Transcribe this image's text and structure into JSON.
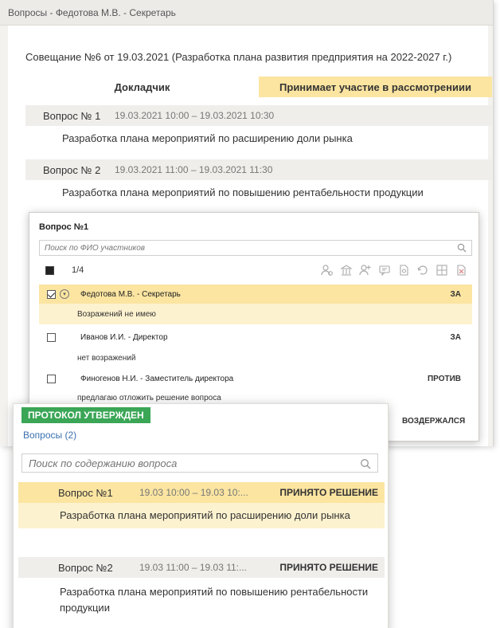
{
  "window1": {
    "title": "Вопросы - Федотова М.В. - Секретарь",
    "meeting": "Совещание №6 от 19.03.2021 (Разработка плана развития предприятия на 2022-2027 г.)",
    "tabs": [
      {
        "label": "Докладчик"
      },
      {
        "label": "Принимает участие в рассмотрениии"
      }
    ],
    "questions": [
      {
        "num": "Вопрос № 1",
        "time": "19.03.2021 10:00 – 19.03.2021 10:30",
        "text": "Разработка плана мероприятий по расширению доли рынка"
      },
      {
        "num": "Вопрос № 2",
        "time": "19.03.2021 11:00 – 19.03.2021 11:30",
        "text": "Разработка плана мероприятий по повышению рентабельности продукции"
      }
    ]
  },
  "window2": {
    "title": "Вопрос №1",
    "search_placeholder": "Поиск по ФИО участников",
    "counter": "1/4",
    "participants": [
      {
        "name": "Федотова М.В. - Секретарь",
        "vote": "ЗА",
        "comment": "Возражений не имею"
      },
      {
        "name": "Иванов И.И. - Директор",
        "vote": "ЗА",
        "comment": "нет возражений"
      },
      {
        "name": "Финогенов Н.И. - Заместитель директора",
        "vote": "ПРОТИВ",
        "comment": "предлагаю отложить решение вопроса"
      }
    ],
    "abstain": "ВОЗДЕРЖАЛСЯ"
  },
  "window3": {
    "badge": "ПРОТОКОЛ УТВЕРЖДЕН",
    "questions_link": "Вопросы (2)",
    "search_placeholder": "Поиск по содержанию вопроса",
    "items": [
      {
        "num": "Вопрос №1",
        "time": "19.03 10:00 – 19.03 10:...",
        "status": "ПРИНЯТО РЕШЕНИЕ",
        "text": "Разработка плана мероприятий по расширению доли рынка"
      },
      {
        "num": "Вопрос №2",
        "time": "19.03 11:00 – 19.03 11:...",
        "status": "ПРИНЯТО РЕШЕНИЕ",
        "text": "Разработка плана мероприятий по повышению рентабельности продукции"
      }
    ]
  },
  "colors": {
    "accent_yellow": "#fbe5a1",
    "accent_yellow_light": "#fdf2cf",
    "badge_green": "#3aa656",
    "link_blue": "#3a6fb0"
  }
}
